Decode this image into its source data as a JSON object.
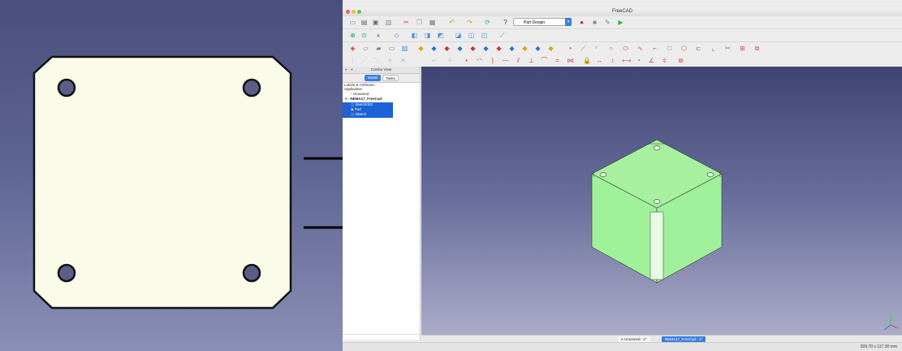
{
  "window": {
    "title": "FreeCAD"
  },
  "toolbar": {
    "workbench_selector": "Part Design"
  },
  "combo_view": {
    "title": "Combo View",
    "tabs": [
      "Model",
      "Tasks"
    ],
    "active_tab": "Model",
    "section_label": "Labels & Attributes",
    "tree": [
      {
        "label": "Application",
        "level": 0,
        "selected": false
      },
      {
        "label": "Unnamed",
        "level": 1,
        "selected": false
      },
      {
        "label": "NEMA17_FreeCad",
        "level": 1,
        "selected": false
      },
      {
        "label": "Sketch003",
        "level": 2,
        "selected": true
      },
      {
        "label": "Pad",
        "level": 2,
        "selected": true
      },
      {
        "label": "Sketch",
        "level": 2,
        "selected": true
      }
    ]
  },
  "document_tabs": [
    {
      "label": "Unnamed : 1*",
      "active": false
    },
    {
      "label": "NEMA17_FreeCad : 1*",
      "active": true
    }
  ],
  "status": {
    "dimensions": "209.70 x 117.30 mm"
  },
  "colors": {
    "plate_fill": "#fbfbea",
    "cube_face_top": "#a7f0a0",
    "cube_face_side": "#9ff29a",
    "selection_blue": "#1b63d6",
    "arrow": "#000000"
  }
}
